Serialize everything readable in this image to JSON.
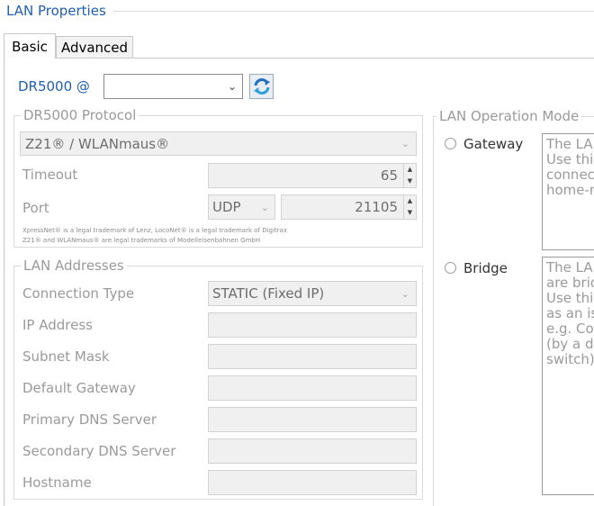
{
  "window": {
    "title": "LAN Properties"
  },
  "tabs": [
    {
      "label": "Basic",
      "active": true
    },
    {
      "label": "Advanced",
      "active": false
    }
  ],
  "device": {
    "label": "DR5000 @",
    "selected": "",
    "refresh_icon": "refresh-icon"
  },
  "protocol": {
    "legend": "DR5000 Protocol",
    "selected": "Z21® / WLANmaus®",
    "timeout_label": "Timeout",
    "timeout_value": "65",
    "port_label": "Port",
    "port_type": "UDP",
    "port_value": "21105",
    "trademark_line1": "XpressNet® is a legal trademark of  Lenz, LocoNet® is a legal trademark of Digitrax",
    "trademark_line2": "Z21® and WLANmaus® are legal trademarks of Modelleisenbahnen GmbH"
  },
  "addresses": {
    "legend": "LAN Addresses",
    "connection_type_label": "Connection Type",
    "connection_type_value": "STATIC (Fixed IP)",
    "ip_label": "IP Address",
    "ip_value": "",
    "subnet_label": "Subnet Mask",
    "subnet_value": "",
    "gateway_label": "Default Gateway",
    "gateway_value": "",
    "dns1_label": "Primary DNS Server",
    "dns1_value": "",
    "dns2_label": "Secondary DNS Server",
    "dns2_value": "",
    "hostname_label": "Hostname",
    "hostname_value": ""
  },
  "mode": {
    "legend": "LAN Operation Mode",
    "gateway_label": "Gateway",
    "gateway_desc": "The LA\nUse thi\nconnec\nhome-n",
    "bridge_label": "Bridge",
    "bridge_desc": "The LA\nare brid\nUse thi\nas an is\ne.g. Co\n(by a d\nswitch)"
  },
  "colors": {
    "accent": "#1f5fb4",
    "disabled_text": "#9a9a9a",
    "field_bg": "#f0f0f0"
  }
}
